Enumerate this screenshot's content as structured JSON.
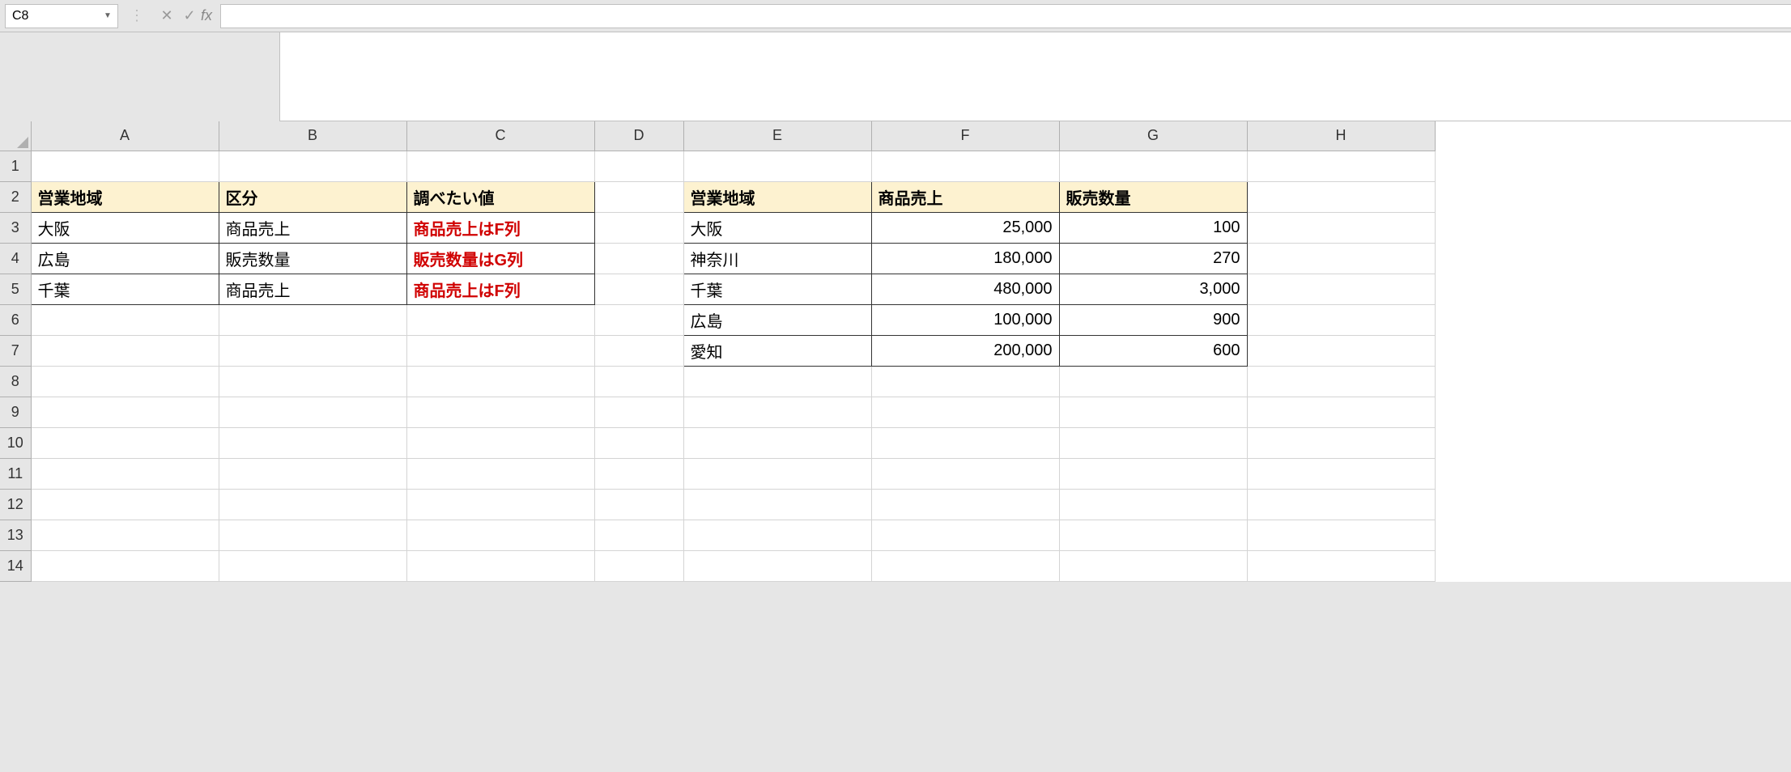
{
  "nameBox": "C8",
  "fx": "fx",
  "formulaValue": "",
  "columns": [
    "A",
    "B",
    "C",
    "D",
    "E",
    "F",
    "G",
    "H"
  ],
  "rows": [
    "1",
    "2",
    "3",
    "4",
    "5",
    "6",
    "7",
    "8",
    "9",
    "10",
    "11",
    "12",
    "13",
    "14"
  ],
  "table1": {
    "headers": {
      "A": "営業地域",
      "B": "区分",
      "C": "調べたい値"
    },
    "rows": [
      {
        "A": "大阪",
        "B": "商品売上",
        "C": "商品売上はF列"
      },
      {
        "A": "広島",
        "B": "販売数量",
        "C": "販売数量はG列"
      },
      {
        "A": "千葉",
        "B": "商品売上",
        "C": "商品売上はF列"
      }
    ]
  },
  "table2": {
    "headers": {
      "E": "営業地域",
      "F": "商品売上",
      "G": "販売数量"
    },
    "rows": [
      {
        "E": "大阪",
        "F": "25,000",
        "G": "100"
      },
      {
        "E": "神奈川",
        "F": "180,000",
        "G": "270"
      },
      {
        "E": "千葉",
        "F": "480,000",
        "G": "3,000"
      },
      {
        "E": "広島",
        "F": "100,000",
        "G": "900"
      },
      {
        "E": "愛知",
        "F": "200,000",
        "G": "600"
      }
    ]
  }
}
